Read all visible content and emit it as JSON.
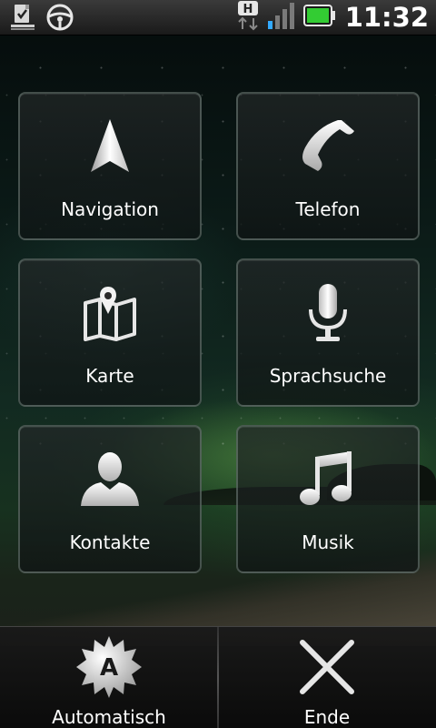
{
  "status_bar": {
    "time": "11:32",
    "network_type": "H",
    "icons": [
      "download-complete-icon",
      "car-mode-icon",
      "hsdpa-data-icon",
      "signal-icon",
      "battery-icon"
    ],
    "battery_color": "#33cc33"
  },
  "tiles": [
    {
      "label": "Navigation",
      "icon": "navigation-arrow-icon"
    },
    {
      "label": "Telefon",
      "icon": "phone-icon"
    },
    {
      "label": "Karte",
      "icon": "map-icon"
    },
    {
      "label": "Sprachsuche",
      "icon": "microphone-icon"
    },
    {
      "label": "Kontakte",
      "icon": "contact-icon"
    },
    {
      "label": "Musik",
      "icon": "music-note-icon"
    }
  ],
  "bottom_bar": {
    "automatic": {
      "label": "Automatisch",
      "icon": "automatic-badge-icon",
      "badge_letter": "A"
    },
    "end": {
      "label": "Ende",
      "icon": "close-x-icon"
    }
  }
}
